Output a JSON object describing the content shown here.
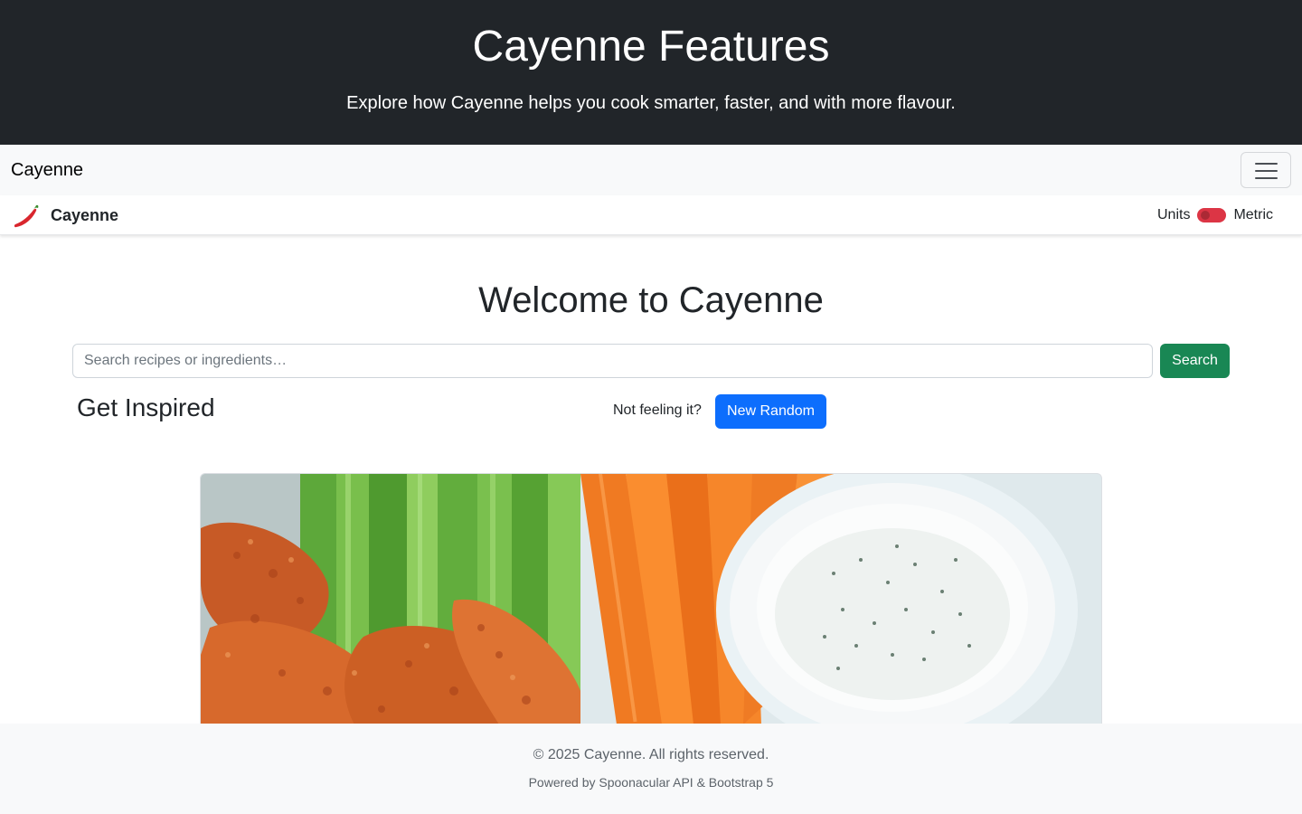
{
  "hero": {
    "title": "Cayenne Features",
    "subtitle": "Explore how Cayenne helps you cook smarter, faster, and with more flavour."
  },
  "navbar": {
    "brand": "Cayenne",
    "toggler_icon": "hamburger-menu-icon"
  },
  "appbar": {
    "logo_icon": "chili-pepper-icon",
    "name": "Cayenne",
    "units_label": "Units",
    "units_value": "Metric",
    "toggle_color": "#dc3545"
  },
  "main": {
    "welcome": "Welcome to Cayenne",
    "search": {
      "placeholder": "Search recipes or ingredients…",
      "button": "Search"
    },
    "inspired": {
      "heading": "Get Inspired",
      "prompt": "Not feeling it?",
      "button": "New Random"
    },
    "recipe_image": {
      "alt": "Crispy buffalo chicken tenders with celery, carrot sticks and ranch dip"
    }
  },
  "footer": {
    "copyright": "© 2025 Cayenne. All rights reserved.",
    "powered": "Powered by Spoonacular API & Bootstrap 5"
  },
  "colors": {
    "hero_bg": "#212529",
    "navbar_bg": "#f8f9fa",
    "search_button": "#198754",
    "random_button": "#0d6efd"
  }
}
